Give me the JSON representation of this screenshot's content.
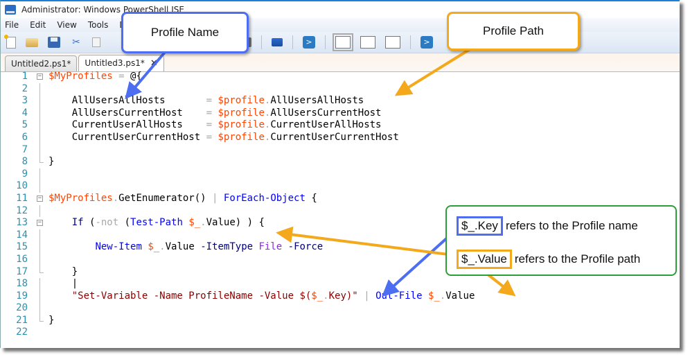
{
  "window": {
    "title": "Administrator: Windows PowerShell ISE"
  },
  "menu": {
    "items": [
      "File",
      "Edit",
      "View",
      "Tools",
      "Debug"
    ]
  },
  "toolbar": {
    "icons": [
      "new-file-icon",
      "open-folder-icon",
      "save-icon",
      "cut-icon",
      "copy-icon",
      "stop-icon",
      "remote-powershell-icon",
      "powershell-icon",
      "layout-top-icon",
      "layout-right-icon",
      "layout-max-icon",
      "show-console-icon"
    ]
  },
  "tabs": [
    {
      "label": "Untitled2.ps1*",
      "active": false
    },
    {
      "label": "Untitled3.ps1*",
      "active": true,
      "close": "✕"
    }
  ],
  "code": {
    "lines": [
      {
        "n": "1",
        "tokens": [
          [
            "var",
            "$MyProfiles"
          ],
          [
            "plain",
            " "
          ],
          [
            "op",
            "="
          ],
          [
            "plain",
            " @{"
          ]
        ]
      },
      {
        "n": "2",
        "tokens": []
      },
      {
        "n": "3",
        "tokens": [
          [
            "plain",
            "    AllUsersAllHosts       "
          ],
          [
            "op",
            "="
          ],
          [
            "plain",
            " "
          ],
          [
            "var",
            "$profile"
          ],
          [
            "op",
            "."
          ],
          [
            "plain",
            "AllUsersAllHosts"
          ]
        ]
      },
      {
        "n": "4",
        "tokens": [
          [
            "plain",
            "    AllUsersCurrentHost    "
          ],
          [
            "op",
            "="
          ],
          [
            "plain",
            " "
          ],
          [
            "var",
            "$profile"
          ],
          [
            "op",
            "."
          ],
          [
            "plain",
            "AllUsersCurrentHost"
          ]
        ]
      },
      {
        "n": "5",
        "tokens": [
          [
            "plain",
            "    CurrentUserAllHosts    "
          ],
          [
            "op",
            "="
          ],
          [
            "plain",
            " "
          ],
          [
            "var",
            "$profile"
          ],
          [
            "op",
            "."
          ],
          [
            "plain",
            "CurrentUserAllHosts"
          ]
        ]
      },
      {
        "n": "6",
        "tokens": [
          [
            "plain",
            "    CurrentUserCurrentHost "
          ],
          [
            "op",
            "="
          ],
          [
            "plain",
            " "
          ],
          [
            "var",
            "$profile"
          ],
          [
            "op",
            "."
          ],
          [
            "plain",
            "CurrentUserCurrentHost"
          ]
        ]
      },
      {
        "n": "7",
        "tokens": []
      },
      {
        "n": "8",
        "tokens": [
          [
            "plain",
            "}"
          ]
        ]
      },
      {
        "n": "9",
        "tokens": []
      },
      {
        "n": "10",
        "tokens": []
      },
      {
        "n": "11",
        "tokens": [
          [
            "var",
            "$MyProfiles"
          ],
          [
            "op",
            "."
          ],
          [
            "plain",
            "GetEnumerator() "
          ],
          [
            "op",
            "|"
          ],
          [
            "plain",
            " "
          ],
          [
            "cmd",
            "ForEach-Object"
          ],
          [
            "plain",
            " {"
          ]
        ]
      },
      {
        "n": "12",
        "tokens": []
      },
      {
        "n": "13",
        "tokens": [
          [
            "plain",
            "    "
          ],
          [
            "kw",
            "If"
          ],
          [
            "plain",
            " ("
          ],
          [
            "op",
            "-not"
          ],
          [
            "plain",
            " ("
          ],
          [
            "cmd",
            "Test-Path"
          ],
          [
            "plain",
            " "
          ],
          [
            "var",
            "$_"
          ],
          [
            "op",
            "."
          ],
          [
            "plain",
            "Value) ) {"
          ]
        ]
      },
      {
        "n": "14",
        "tokens": []
      },
      {
        "n": "15",
        "tokens": [
          [
            "plain",
            "        "
          ],
          [
            "cmd",
            "New-Item"
          ],
          [
            "plain",
            " "
          ],
          [
            "var",
            "$_"
          ],
          [
            "op",
            "."
          ],
          [
            "plain",
            "Value "
          ],
          [
            "param",
            "-ItemType"
          ],
          [
            "plain",
            " "
          ],
          [
            "typ",
            "File"
          ],
          [
            "plain",
            " "
          ],
          [
            "param",
            "-Force"
          ]
        ]
      },
      {
        "n": "16",
        "tokens": []
      },
      {
        "n": "17",
        "tokens": [
          [
            "plain",
            "    }"
          ]
        ]
      },
      {
        "n": "18",
        "tokens": [
          [
            "plain",
            "    |"
          ]
        ]
      },
      {
        "n": "19",
        "tokens": [
          [
            "plain",
            "    "
          ],
          [
            "str",
            "\"Set-Variable -Name ProfileName -Value $("
          ],
          [
            "var",
            "$_"
          ],
          [
            "op",
            "."
          ],
          [
            "str",
            "Key)\""
          ],
          [
            "plain",
            " "
          ],
          [
            "op",
            "|"
          ],
          [
            "plain",
            " "
          ],
          [
            "cmd",
            "Out-File"
          ],
          [
            "plain",
            " "
          ],
          [
            "var",
            "$_"
          ],
          [
            "op",
            "."
          ],
          [
            "plain",
            "Value"
          ]
        ]
      },
      {
        "n": "20",
        "tokens": []
      },
      {
        "n": "21",
        "tokens": [
          [
            "plain",
            "}"
          ]
        ]
      },
      {
        "n": "22",
        "tokens": []
      }
    ]
  },
  "annotations": {
    "profile_name": "Profile Name",
    "profile_path": "Profile Path",
    "legend": {
      "key_token": "$_.Key",
      "key_text": "refers to the Profile name",
      "value_token": "$_.Value",
      "value_text": "refers to the Profile path"
    },
    "colors": {
      "blue": "#4d6ef0",
      "orange": "#f4a91c",
      "green": "#2e9e3a"
    }
  }
}
